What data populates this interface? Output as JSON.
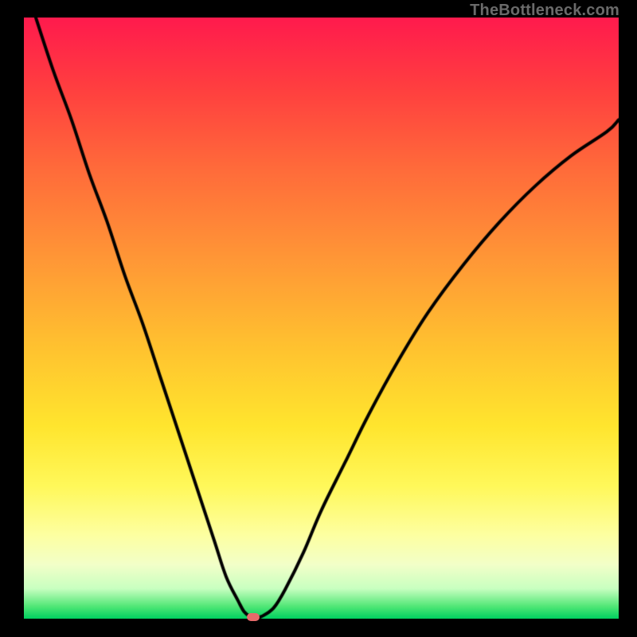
{
  "attribution": "TheBottleneck.com",
  "colors": {
    "page_bg": "#000000",
    "attribution_text": "#6a6a6a",
    "curve_stroke": "#000000",
    "marker_fill": "#e66a6a",
    "gradient_stops": [
      {
        "offset": 0,
        "color": "#ff1a4d"
      },
      {
        "offset": 12,
        "color": "#ff3f3f"
      },
      {
        "offset": 25,
        "color": "#ff6a3a"
      },
      {
        "offset": 40,
        "color": "#ff9636"
      },
      {
        "offset": 55,
        "color": "#ffc22f"
      },
      {
        "offset": 68,
        "color": "#ffe52e"
      },
      {
        "offset": 78,
        "color": "#fff85a"
      },
      {
        "offset": 86,
        "color": "#fdffa0"
      },
      {
        "offset": 91,
        "color": "#f2ffc8"
      },
      {
        "offset": 95,
        "color": "#c8ffc0"
      },
      {
        "offset": 98,
        "color": "#4fe675"
      },
      {
        "offset": 100,
        "color": "#00d060"
      }
    ]
  },
  "chart_data": {
    "type": "line",
    "title": "",
    "xlabel": "",
    "ylabel": "",
    "xlim": [
      0,
      100
    ],
    "ylim": [
      0,
      100
    ],
    "grid": false,
    "series": [
      {
        "name": "bottleneck-curve",
        "x": [
          2,
          5,
          8,
          11,
          14,
          17,
          20,
          23,
          26,
          29,
          32,
          34,
          36,
          37,
          38,
          39,
          40,
          42,
          44,
          47,
          50,
          54,
          58,
          63,
          68,
          74,
          80,
          86,
          92,
          98,
          100
        ],
        "y": [
          100,
          91,
          83,
          74,
          66,
          57,
          49,
          40,
          31,
          22,
          13,
          7,
          3,
          1.2,
          0.4,
          0.2,
          0.4,
          1.8,
          5,
          11,
          18,
          26,
          34,
          43,
          51,
          59,
          66,
          72,
          77,
          81,
          83
        ]
      }
    ],
    "marker": {
      "x": 38.5,
      "y": 0.3
    }
  }
}
